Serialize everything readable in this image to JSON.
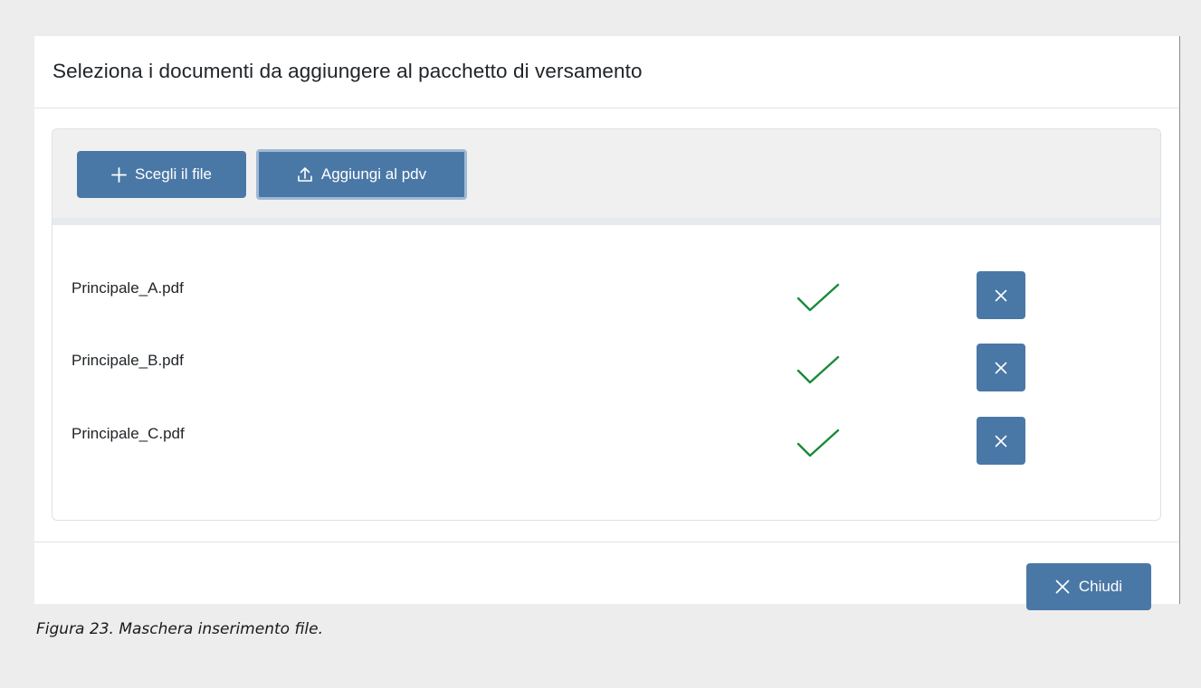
{
  "dialog": {
    "title": "Seleziona i documenti da aggiungere al pacchetto di versamento"
  },
  "toolbar": {
    "choose_label": "Scegli il file",
    "choose_icon": "plus-icon",
    "add_label": "Aggiungi al pdv",
    "add_icon": "upload-icon"
  },
  "files": [
    {
      "name": "Principale_A.pdf",
      "status": "uploaded"
    },
    {
      "name": "Principale_B.pdf",
      "status": "uploaded"
    },
    {
      "name": "Principale_C.pdf",
      "status": "uploaded"
    }
  ],
  "footer": {
    "close_label": "Chiudi",
    "close_icon": "close-icon"
  },
  "caption": "Figura 23. Maschera inserimento file.",
  "colors": {
    "button": "#4a78a6",
    "button_focus_ring": "#9fb9d4",
    "success_check": "#1a8a3a",
    "page_background": "#ededed"
  }
}
